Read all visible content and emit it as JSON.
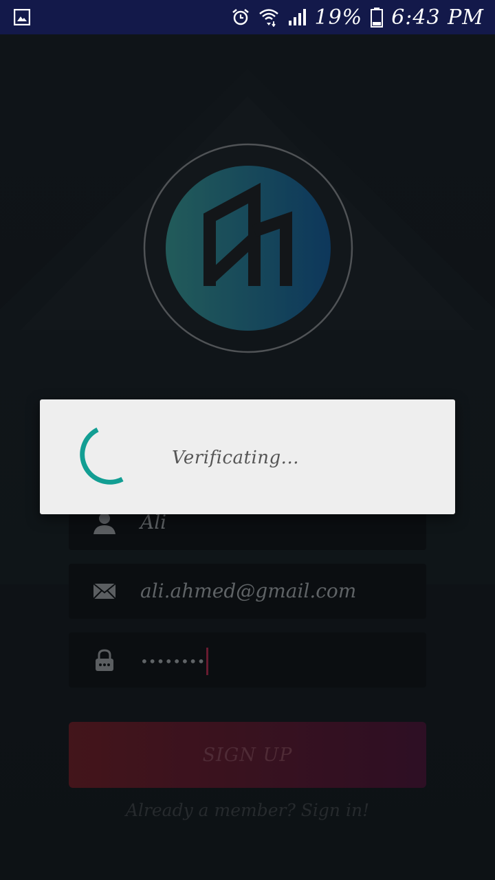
{
  "status_bar": {
    "battery_percent": "19%",
    "time": "6:43 PM",
    "icons": [
      "gallery-icon",
      "alarm-icon",
      "wifi-icon",
      "signal-icon",
      "battery-icon"
    ],
    "background": "#13194a"
  },
  "form": {
    "name_value": "Ali",
    "email_value": "ali.ahmed@gmail.com",
    "password_value": "••••••••",
    "signup_label": "SIGN UP",
    "signin_link": "Already a member? Sign in!"
  },
  "dialog": {
    "message": "Verificating...",
    "spinner_color": "#129e93"
  },
  "colors": {
    "signup_gradient_start": "#5a1c24",
    "signup_gradient_end": "#3d1430",
    "logo_gradient_start": "#2e7a78",
    "logo_gradient_end": "#124a7a"
  }
}
